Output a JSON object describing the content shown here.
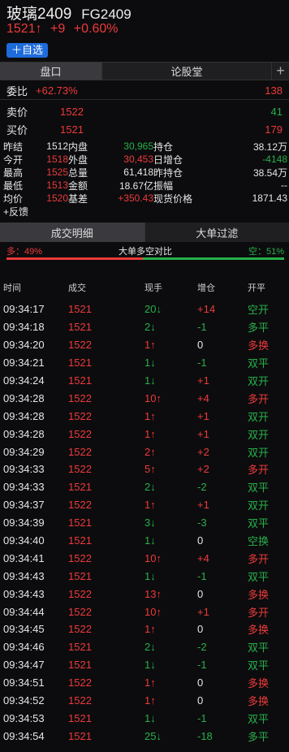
{
  "header": {
    "name": "玻璃2409",
    "code": "FG2409",
    "price": "1521↑",
    "change": "+9",
    "change_pct": "+0.60%",
    "add_watch": "＋自选"
  },
  "tabs_top": [
    "盘口",
    "论股堂"
  ],
  "tab_add": "+",
  "orderbook": {
    "weibi_label": "委比",
    "weibi_value": "+62.73%",
    "weibi_vol": "138",
    "sell_label": "卖价",
    "sell_price": "1522",
    "sell_vol": "41",
    "buy_label": "买价",
    "buy_price": "1521",
    "buy_vol": "179"
  },
  "stats": [
    {
      "l1": "昨结",
      "v1": "1512",
      "l2": "内盘",
      "v2": "30,965",
      "l3": "持仓",
      "v3": "38.12万"
    },
    {
      "l1": "今开",
      "v1": "1518",
      "l2": "外盘",
      "v2": "30,453",
      "l3": "日增仓",
      "v3": "-4148"
    },
    {
      "l1": "最高",
      "v1": "1525",
      "l2": "总量",
      "v2": "61,418",
      "l3": "昨持仓",
      "v3": "38.54万"
    },
    {
      "l1": "最低",
      "v1": "1513",
      "l2": "金额",
      "v2": "18.67亿",
      "l3": "振幅",
      "v3": "--"
    },
    {
      "l1": "均价",
      "v1": "1520",
      "l2": "基差",
      "v2": "+350.43",
      "l3": "现货价格",
      "v3": "1871.43"
    }
  ],
  "feedback": "+反馈",
  "tabs_detail": [
    "成交明细",
    "大单过滤"
  ],
  "ratio": {
    "long_label": "多：49%",
    "title": "大单多空对比",
    "short_label": "空：51%",
    "long_pct": 49,
    "short_pct": 51
  },
  "trade_columns": [
    "时间",
    "成交",
    "现手",
    "增仓",
    "开平"
  ],
  "trades": [
    {
      "time": "09:34:17",
      "price": "1521",
      "vol": "20↓",
      "oi": "+14",
      "type": "空开"
    },
    {
      "time": "09:34:18",
      "price": "1521",
      "vol": "2↓",
      "oi": "-1",
      "type": "多平"
    },
    {
      "time": "09:34:20",
      "price": "1522",
      "vol": "1↑",
      "oi": "0",
      "type": "多换"
    },
    {
      "time": "09:34:21",
      "price": "1521",
      "vol": "1↓",
      "oi": "-1",
      "type": "双平"
    },
    {
      "time": "09:34:24",
      "price": "1521",
      "vol": "1↓",
      "oi": "+1",
      "type": "双开"
    },
    {
      "time": "09:34:28",
      "price": "1522",
      "vol": "10↑",
      "oi": "+4",
      "type": "多开"
    },
    {
      "time": "09:34:28",
      "price": "1522",
      "vol": "1↑",
      "oi": "+1",
      "type": "双开"
    },
    {
      "time": "09:34:28",
      "price": "1522",
      "vol": "1↑",
      "oi": "+1",
      "type": "双开"
    },
    {
      "time": "09:34:29",
      "price": "1522",
      "vol": "2↑",
      "oi": "+2",
      "type": "双开"
    },
    {
      "time": "09:34:33",
      "price": "1522",
      "vol": "5↑",
      "oi": "+2",
      "type": "多开"
    },
    {
      "time": "09:34:33",
      "price": "1521",
      "vol": "2↓",
      "oi": "-2",
      "type": "双平"
    },
    {
      "time": "09:34:37",
      "price": "1522",
      "vol": "1↑",
      "oi": "+1",
      "type": "双开"
    },
    {
      "time": "09:34:39",
      "price": "1521",
      "vol": "3↓",
      "oi": "-3",
      "type": "双平"
    },
    {
      "time": "09:34:40",
      "price": "1521",
      "vol": "1↓",
      "oi": "0",
      "type": "空换"
    },
    {
      "time": "09:34:41",
      "price": "1522",
      "vol": "10↑",
      "oi": "+4",
      "type": "多开"
    },
    {
      "time": "09:34:43",
      "price": "1521",
      "vol": "1↓",
      "oi": "-1",
      "type": "双平"
    },
    {
      "time": "09:34:43",
      "price": "1522",
      "vol": "13↑",
      "oi": "0",
      "type": "多换"
    },
    {
      "time": "09:34:44",
      "price": "1522",
      "vol": "10↑",
      "oi": "+1",
      "type": "多开"
    },
    {
      "time": "09:34:45",
      "price": "1522",
      "vol": "1↑",
      "oi": "0",
      "type": "多换"
    },
    {
      "time": "09:34:46",
      "price": "1521",
      "vol": "2↓",
      "oi": "-2",
      "type": "双平"
    },
    {
      "time": "09:34:47",
      "price": "1521",
      "vol": "1↓",
      "oi": "-1",
      "type": "双平"
    },
    {
      "time": "09:34:51",
      "price": "1522",
      "vol": "1↑",
      "oi": "0",
      "type": "多换"
    },
    {
      "time": "09:34:52",
      "price": "1522",
      "vol": "1↑",
      "oi": "0",
      "type": "多换"
    },
    {
      "time": "09:34:53",
      "price": "1521",
      "vol": "1↓",
      "oi": "-1",
      "type": "双平"
    },
    {
      "time": "09:34:54",
      "price": "1521",
      "vol": "25↓",
      "oi": "-18",
      "type": "多平"
    }
  ],
  "colors": {
    "up": "#ee3a3a",
    "down": "#27b04a",
    "accent": "#1e6bdc"
  }
}
